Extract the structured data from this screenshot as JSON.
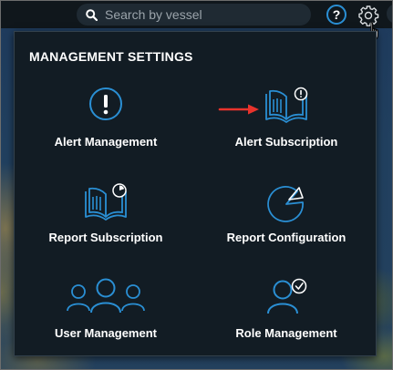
{
  "search": {
    "placeholder": "Search by vessel"
  },
  "toolbar": {
    "help_label": "?"
  },
  "panel": {
    "title": "MANAGEMENT SETTINGS",
    "items": [
      {
        "label": "Alert Management",
        "icon": "alert-icon"
      },
      {
        "label": "Alert Subscription",
        "icon": "book-alert-icon"
      },
      {
        "label": "Report Subscription",
        "icon": "book-chart-icon"
      },
      {
        "label": "Report Configuration",
        "icon": "pie-chart-icon"
      },
      {
        "label": "User Management",
        "icon": "users-group-icon"
      },
      {
        "label": "Role Management",
        "icon": "user-check-icon"
      }
    ]
  },
  "colors": {
    "accent": "#2a8fd4",
    "panel_bg": "#121c24",
    "annotation_arrow": "#e8332c"
  }
}
